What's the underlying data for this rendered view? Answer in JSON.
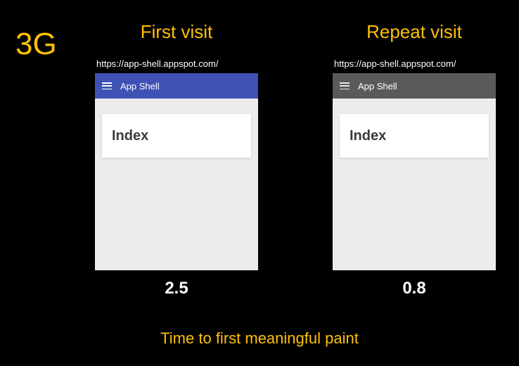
{
  "network_label": "3G",
  "caption": "Time to first meaningful paint",
  "columns": {
    "first": {
      "heading": "First visit",
      "url": "https://app-shell.appspot.com/",
      "app_title": "App Shell",
      "card_title": "Index",
      "timing": "2.5"
    },
    "repeat": {
      "heading": "Repeat visit",
      "url": "https://app-shell.appspot.com/",
      "app_title": "App Shell",
      "card_title": "Index",
      "timing": "0.8"
    }
  }
}
